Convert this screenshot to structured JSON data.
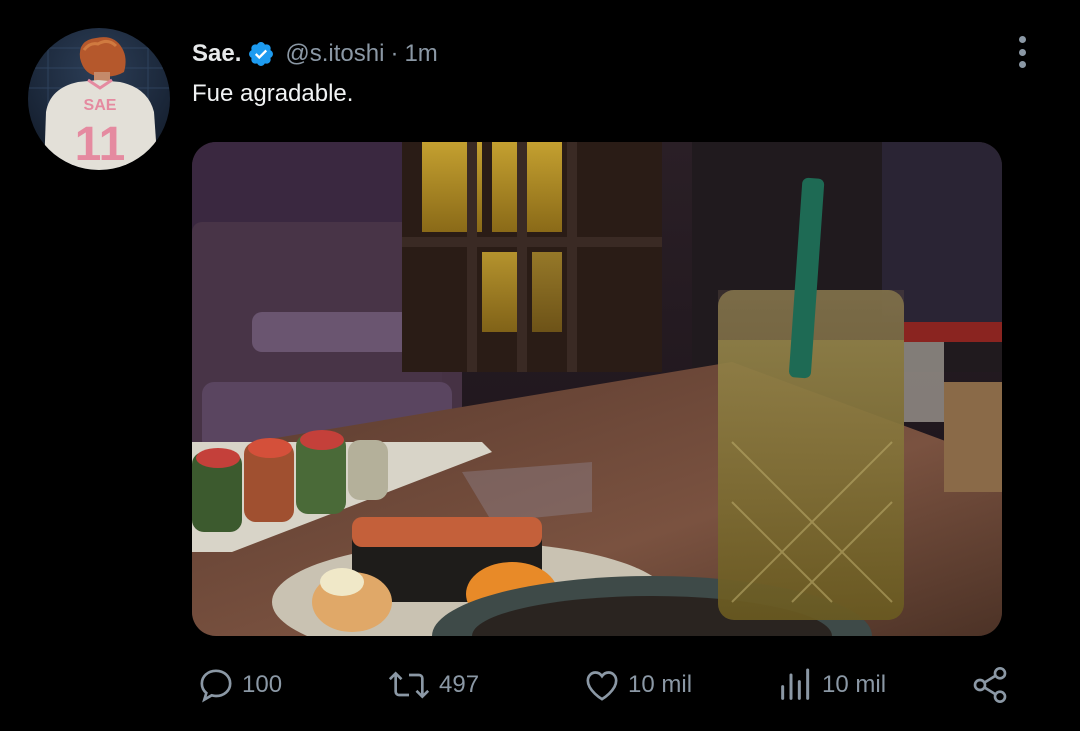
{
  "tweet": {
    "author": {
      "display_name": "Sae.",
      "verified_icon": "verified-badge-icon",
      "handle": "@s.itoshi",
      "separator": "·",
      "time": "1m",
      "avatar_jersey_text": "SAE",
      "avatar_jersey_number": "11"
    },
    "text": "Fue agradable.",
    "media": {
      "description_icon": "photo",
      "visible": true
    },
    "actions": {
      "replies": {
        "icon": "reply-icon",
        "count": "100"
      },
      "retweets": {
        "icon": "retweet-icon",
        "count": "497"
      },
      "likes": {
        "icon": "heart-icon",
        "count": "10 mil"
      },
      "views": {
        "icon": "views-icon",
        "count": "10 mil"
      },
      "share": {
        "icon": "share-icon"
      }
    }
  },
  "colors": {
    "background": "#000000",
    "text_primary": "#e7e9ea",
    "text_secondary": "#8b98a5",
    "verified": "#1d9bf0"
  }
}
